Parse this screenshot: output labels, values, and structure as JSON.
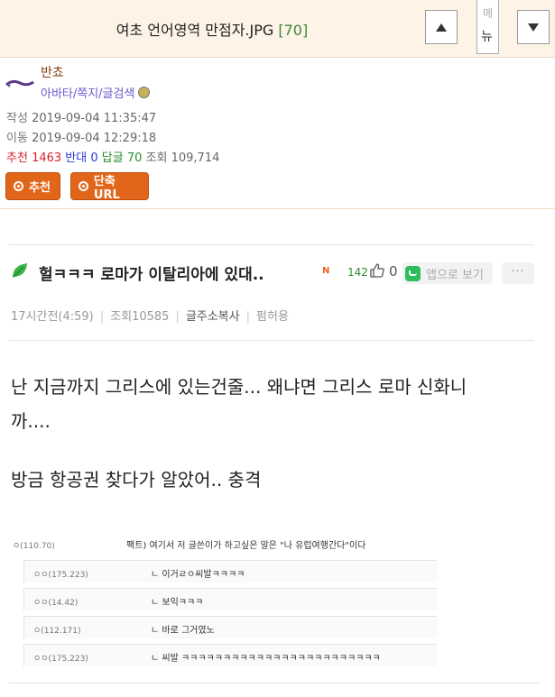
{
  "header": {
    "title": "여초 언어영역 만점자.JPG",
    "count": "[70]",
    "menu_label_top": "메",
    "menu_label": "뉴"
  },
  "author": {
    "name": "반쵸",
    "links": "아바타/쪽지/글검색"
  },
  "meta": {
    "written_label": "작성",
    "written": "2019-09-04 11:35:47",
    "moved_label": "이동",
    "moved": "2019-09-04 12:29:18"
  },
  "stats": {
    "rec_label": "추천",
    "rec": "1463",
    "opp_label": "반대",
    "opp": "0",
    "reply_label": "답글",
    "reply": "70",
    "views_label": "조회",
    "views": "109,714"
  },
  "buttons": {
    "recommend": "추천",
    "shorturl": "단축URL"
  },
  "post": {
    "title": "헐ㅋㅋㅋ 로마가 이탈리아에 있대..",
    "n_badge": "N",
    "likes": "142",
    "likes2": "0",
    "app_view": "앱으로 보기",
    "more": "···",
    "time": "17시간전(4:59)",
    "views": "조회10585",
    "copy_link": "글주소복사",
    "permission": "펌허용",
    "line1": "난 지금까지 그리스에 있는건줄... 왜냐면 그리스 로마 신화니",
    "line2": "까....",
    "line3": "방금 항공권 찾다가 알았어.. 충격"
  },
  "comments_image": {
    "top": {
      "ip": "ㅇ(110.70)",
      "text": "팩트) 여기서 저 글쓴이가 하고싶은 말은 \"나 유럽여행간다\"이다"
    },
    "rows": [
      {
        "ip": "ㅇㅇ(175.223)",
        "text": "ㄴ 이거ㄹㅇ씨발ㅋㅋㅋㅋ"
      },
      {
        "ip": "ㅇㅇ(14.42)",
        "text": "ㄴ 보익ㅋㅋㅋ"
      },
      {
        "ip": "ㅇ(112.171)",
        "text": "ㄴ 바로 그거였노"
      },
      {
        "ip": "ㅇㅇ(175.223)",
        "text": "ㄴ 씨발 ㅋㅋㅋㅋㅋㅋㅋㅋㅋㅋㅋㅋㅋㅋㅋㅋㅋㅋㅋㅋㅋㅋㅋㅋ"
      }
    ]
  },
  "colors": {
    "accent": "#e2661a",
    "header_bg": "#fdf3e7",
    "recommend_red": "#d9232d",
    "opposite_blue": "#2b3bd6",
    "reply_green": "#2e8b2e"
  }
}
